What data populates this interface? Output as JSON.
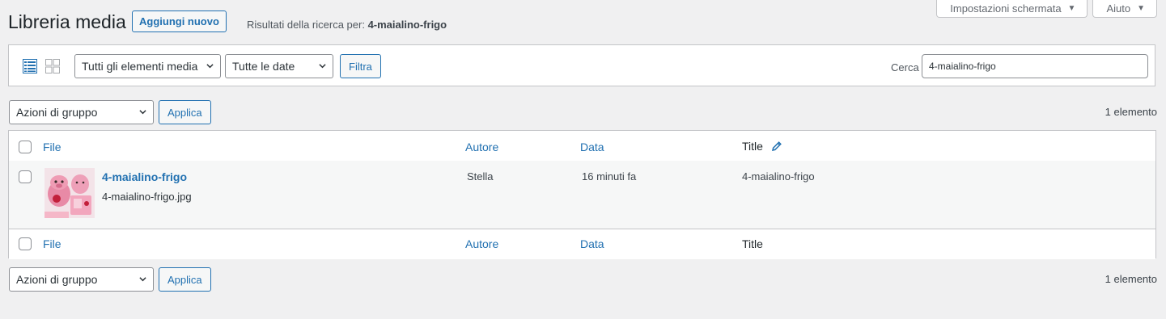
{
  "screen_tabs": [
    {
      "label": "Impostazioni schermata",
      "icon": "triangle-down-icon"
    },
    {
      "label": "Aiuto",
      "icon": "triangle-down-icon"
    }
  ],
  "header": {
    "title": "Libreria media",
    "add_new": "Aggiungi nuovo",
    "search_results_prefix": "Risultati della ricerca per: ",
    "search_results_term": "4-maialino-frigo"
  },
  "filters": {
    "media_type": "Tutti gli elementi media",
    "dates": "Tutte le date",
    "filter_button": "Filtra",
    "search_label": "Cerca",
    "search_value": "4-maialino-frigo"
  },
  "bulk_top": {
    "action": "Azioni di gruppo",
    "apply": "Applica",
    "count": "1 elemento"
  },
  "bulk_bottom": {
    "action": "Azioni di gruppo",
    "apply": "Applica",
    "count": "1 elemento"
  },
  "table": {
    "columns": {
      "file": "File",
      "author": "Autore",
      "date": "Data",
      "title": "Title"
    },
    "rows": [
      {
        "title": "4-maialino-frigo",
        "filename": "4-maialino-frigo.jpg",
        "author": "Stella",
        "date": "16 minuti fa",
        "title_field": "4-maialino-frigo"
      }
    ]
  },
  "colors": {
    "accent": "#2271b1",
    "background": "#f0f0f1",
    "border": "#c3c4c7"
  }
}
